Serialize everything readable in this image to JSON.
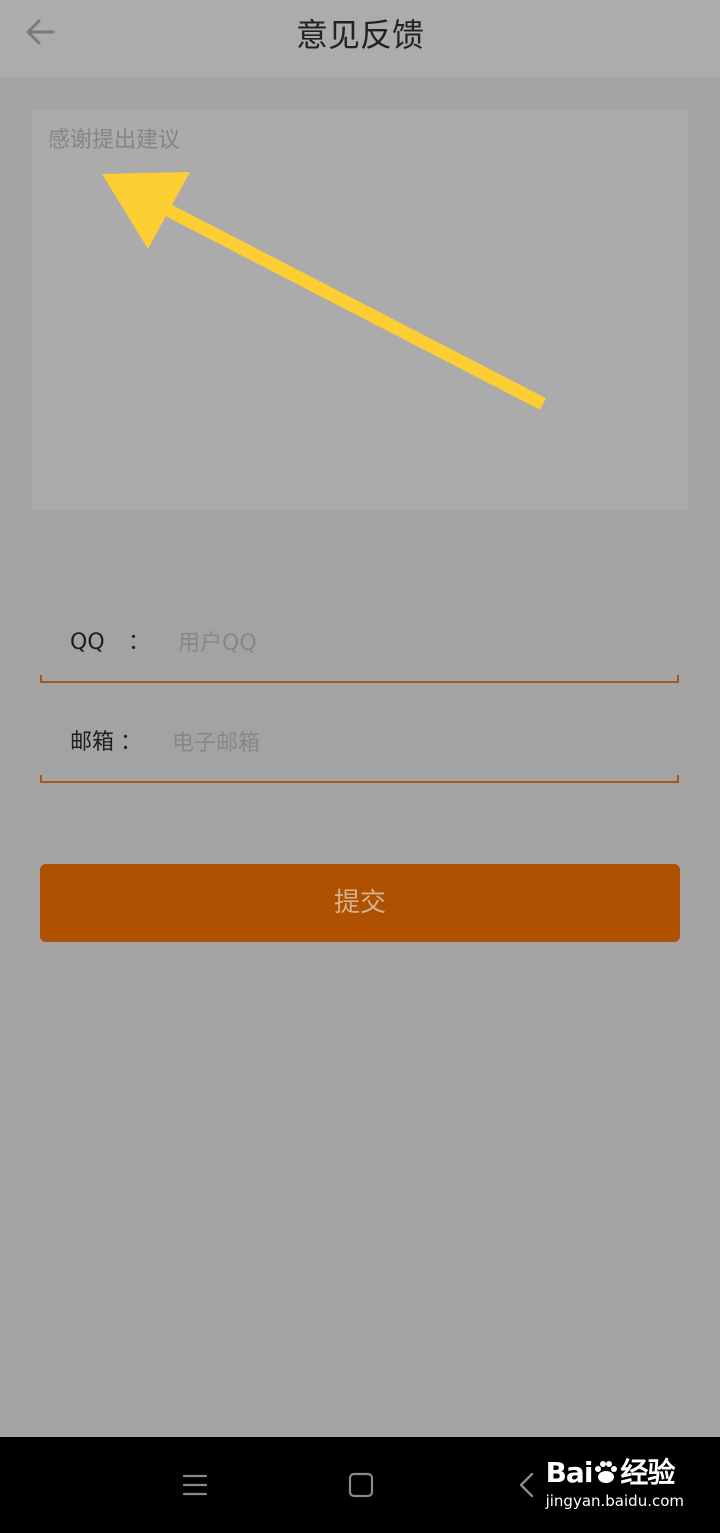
{
  "header": {
    "title": "意见反馈",
    "back_icon": "arrow-left-icon"
  },
  "feedback": {
    "placeholder": "感谢提出建议",
    "value": ""
  },
  "fields": {
    "qq": {
      "label": "QQ",
      "colon": "：",
      "placeholder": "用户QQ",
      "value": ""
    },
    "email": {
      "label": "邮箱",
      "colon": "：",
      "placeholder": "电子邮箱",
      "value": ""
    }
  },
  "submit": {
    "label": "提交"
  },
  "annotation": {
    "arrow_color": "#fdcd34",
    "icon": "arrow-annotation-icon"
  },
  "system_nav": {
    "menu_icon": "menu-icon",
    "home_icon": "home-icon",
    "back_icon": "back-chevron-icon"
  },
  "watermark": {
    "brand_left": "Bai",
    "brand_right": "经验",
    "url": "jingyan.baidu.com"
  },
  "colors": {
    "accent": "#ae5100",
    "underline": "#a8561a",
    "overlay_bg": "#a3a3a3",
    "arrow": "#fdcd34"
  }
}
